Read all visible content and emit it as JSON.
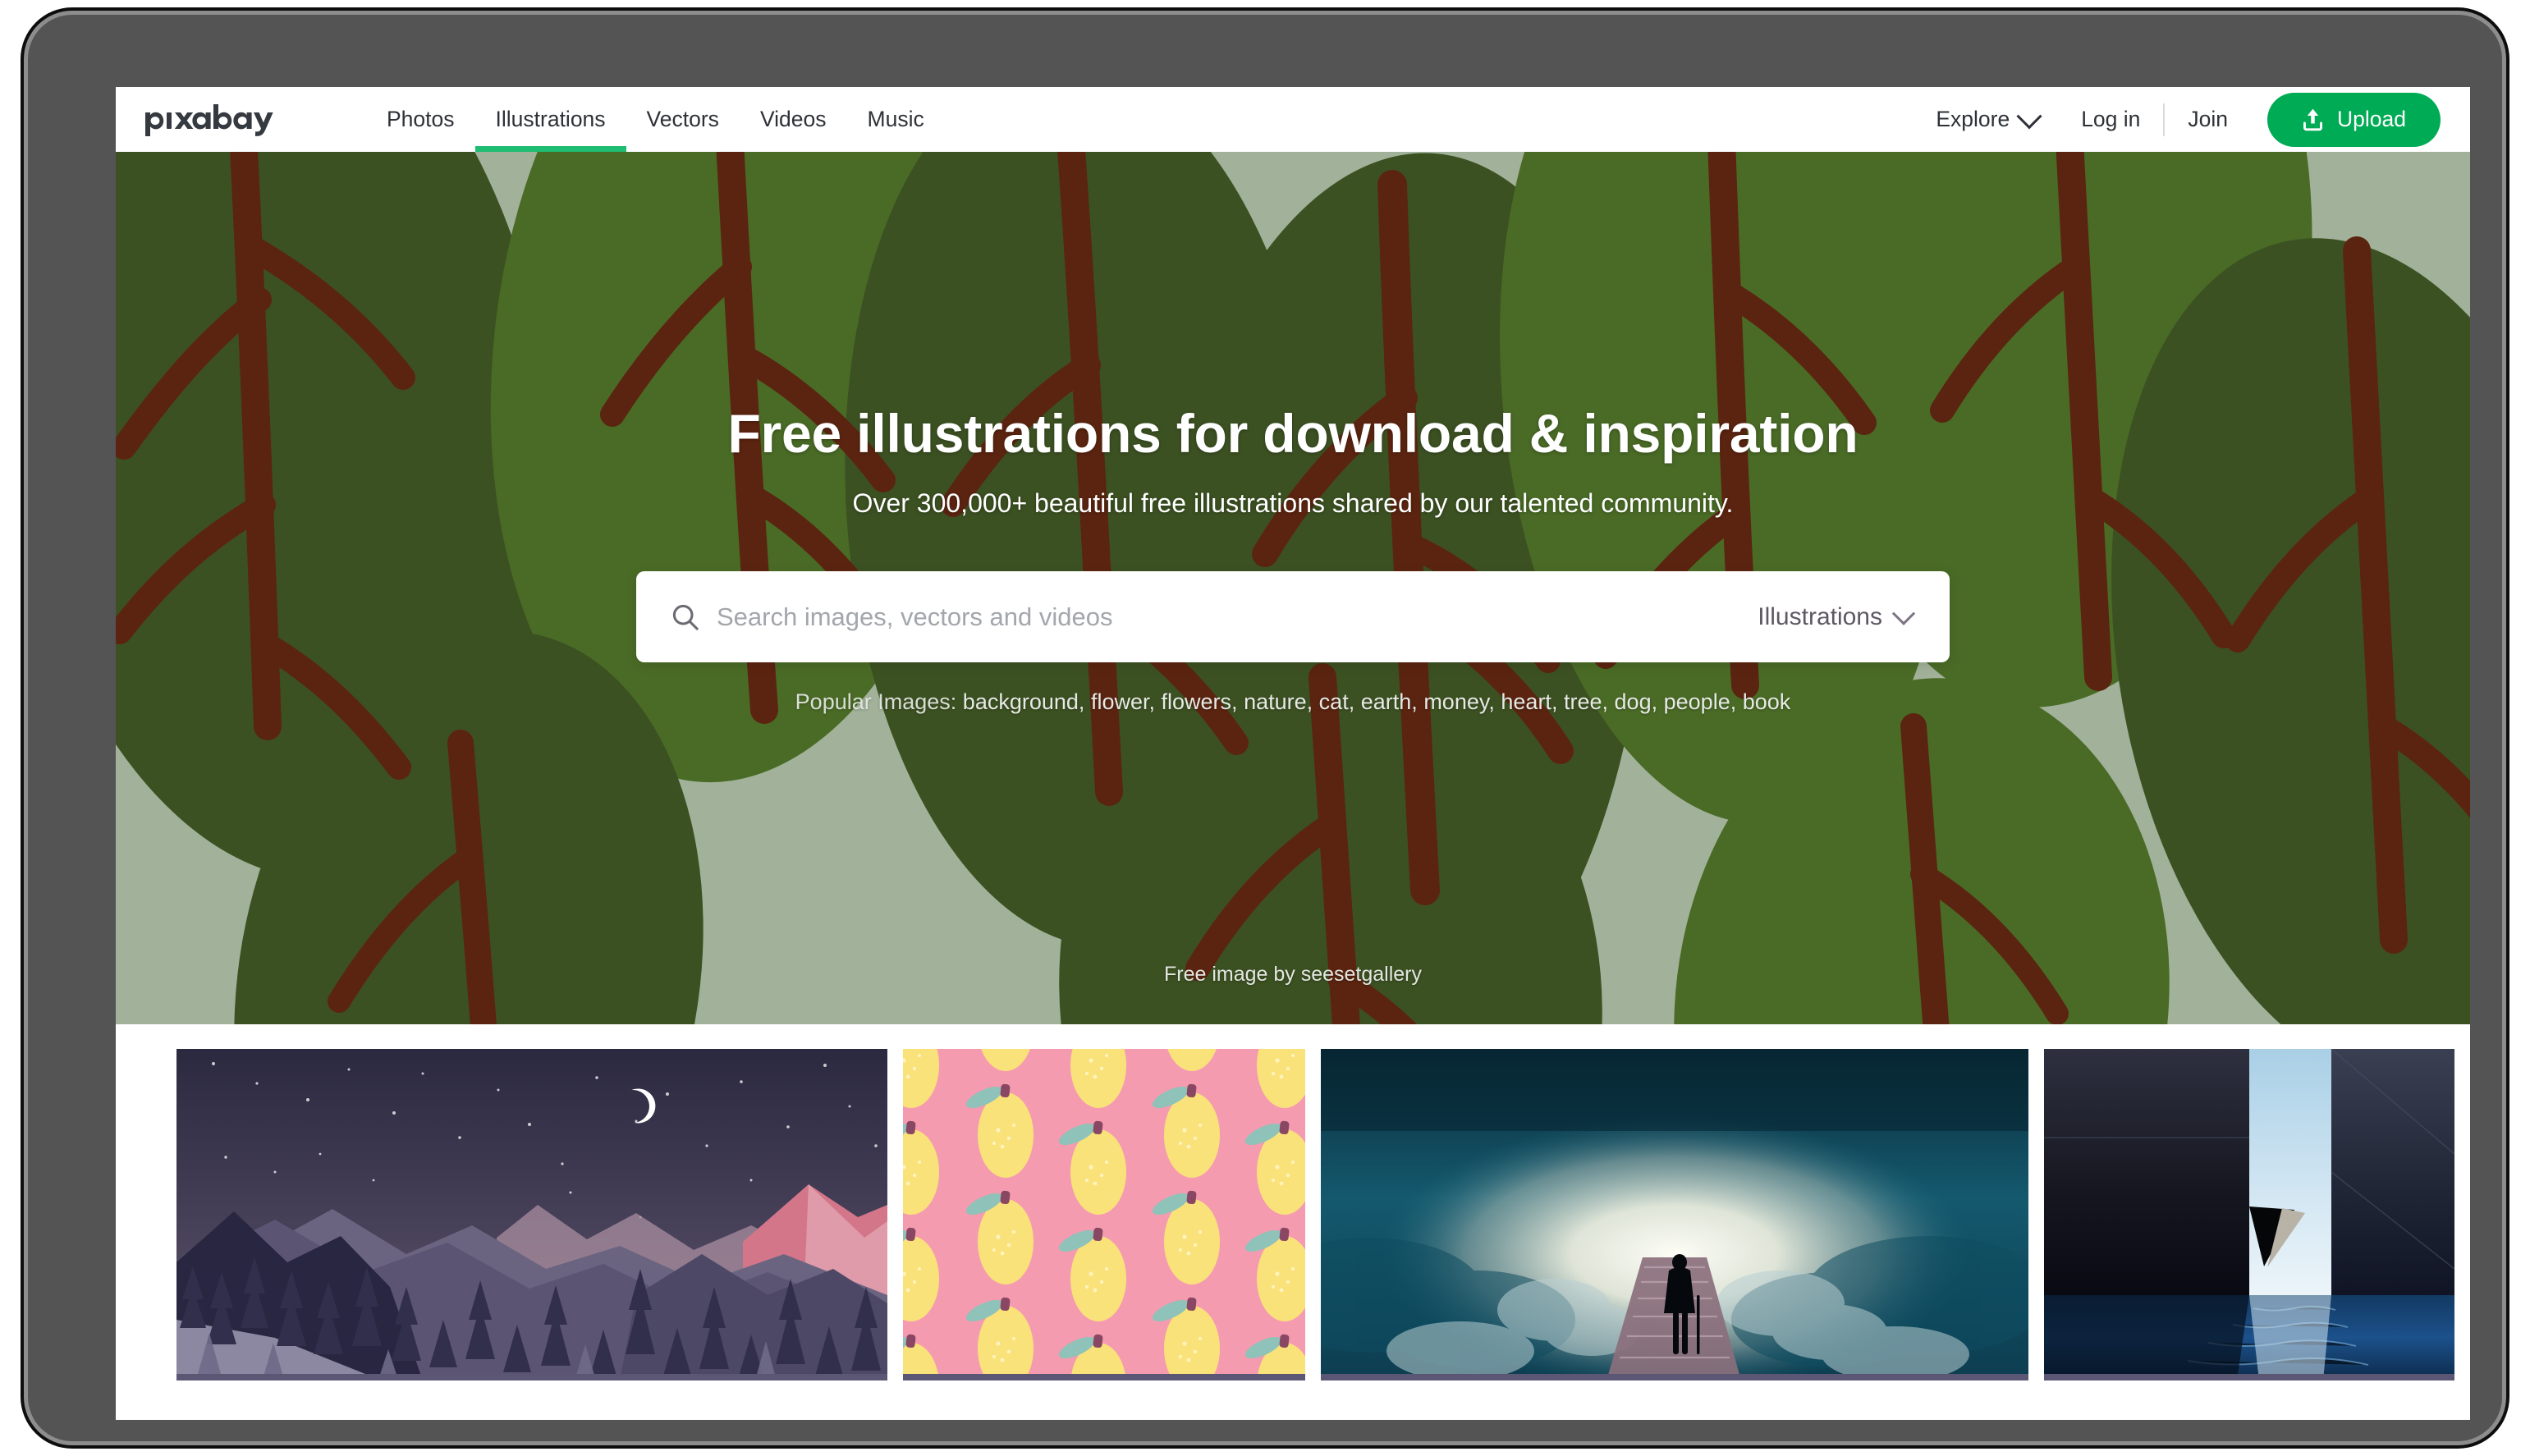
{
  "site": {
    "logo_text": "pixabay",
    "logo_name": "pixabay-logo"
  },
  "header": {
    "nav": [
      {
        "label": "Photos",
        "active": false
      },
      {
        "label": "Illustrations",
        "active": true
      },
      {
        "label": "Vectors",
        "active": false
      },
      {
        "label": "Videos",
        "active": false
      },
      {
        "label": "Music",
        "active": false
      }
    ],
    "explore_label": "Explore",
    "login_label": "Log in",
    "join_label": "Join",
    "upload_label": "Upload",
    "accent_green": "#00ab55",
    "active_underline": "#1ebd72"
  },
  "hero": {
    "title": "Free illustrations for download & inspiration",
    "subtitle": "Over 300,000+ beautiful free illustrations shared by our talented community.",
    "attribution": "Free image by seesetgallery",
    "background": {
      "name": "leaf-pattern-illustration",
      "base_color": "#a2b29a",
      "leaf_dark": "#3c5122",
      "leaf_mid": "#4a6b26",
      "stem_color": "#5b2410"
    }
  },
  "search": {
    "placeholder": "Search images, vectors and videos",
    "value": "",
    "type_label": "Illustrations",
    "icon": "search-icon"
  },
  "popular": {
    "label": "Popular Images:",
    "items": [
      "background",
      "flower",
      "flowers",
      "nature",
      "cat",
      "earth",
      "money",
      "heart",
      "tree",
      "dog",
      "people",
      "book"
    ]
  },
  "gallery": {
    "items": [
      {
        "name": "night-mountains-moon-illustration",
        "alt": "Night mountain landscape with crescent moon"
      },
      {
        "name": "lemon-pattern-illustration",
        "alt": "Yellow lemons pattern on pink background"
      },
      {
        "name": "stairway-to-light-clouds",
        "alt": "Silhouette walking a stairway through clouds toward light"
      },
      {
        "name": "dark-concrete-water-architecture",
        "alt": "Dark concrete walls with water and light gap"
      }
    ]
  }
}
